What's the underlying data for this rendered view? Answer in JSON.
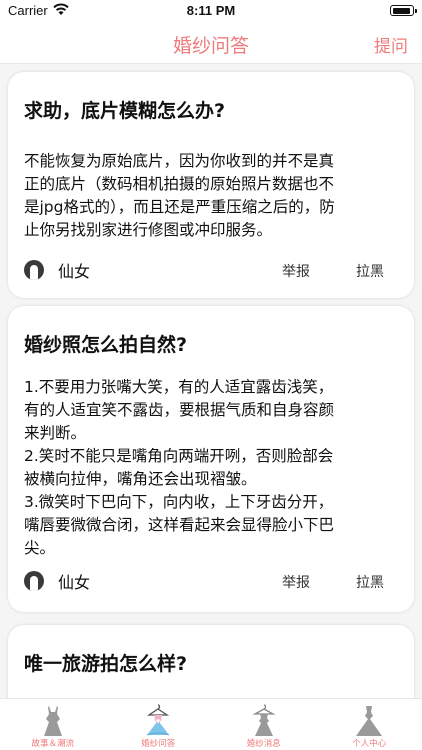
{
  "status_bar": {
    "carrier": "Carrier",
    "time": "8:11 PM"
  },
  "nav": {
    "title": "婚纱问答",
    "action": "提问"
  },
  "colors": {
    "accent": "#ef7b7b"
  },
  "posts": [
    {
      "question": "求助，底片模糊怎么办?",
      "answer": "不能恢复为原始底片，因为你收到的并不是真\n正的底片（数码相机拍摄的原始照片数据也不\n是jpg格式的），而且还是严重压缩之后的，防\n止你另找别家进行修图或冲印服务。",
      "author": "仙女",
      "report": "举报",
      "block": "拉黑"
    },
    {
      "question": "婚纱照怎么拍自然?",
      "answer": "1.不要用力张嘴大笑，有的人适宜露齿浅笑，\n有的人适宜笑不露齿，要根据气质和自身容颜\n来判断。\n2.笑时不能只是嘴角向两端开咧，否则脸部会\n被横向拉伸，嘴角还会出现褶皱。\n3.微笑时下巴向下，向内收，上下牙齿分开，\n嘴唇要微微合闭，这样看起来会显得脸小下巴\n尖。",
      "author": "仙女",
      "report": "举报",
      "block": "拉黑"
    },
    {
      "question": "唯一旅游拍怎么样?"
    }
  ],
  "tabs": [
    {
      "label": "故事＆潮流",
      "icon": "dress-icon",
      "active": false
    },
    {
      "label": "婚纱问答",
      "icon": "dress-on-hanger-icon",
      "active": true
    },
    {
      "label": "婚纱消息",
      "icon": "hanger-dress-icon",
      "active": false
    },
    {
      "label": "个人中心",
      "icon": "gown-icon",
      "active": false
    }
  ]
}
